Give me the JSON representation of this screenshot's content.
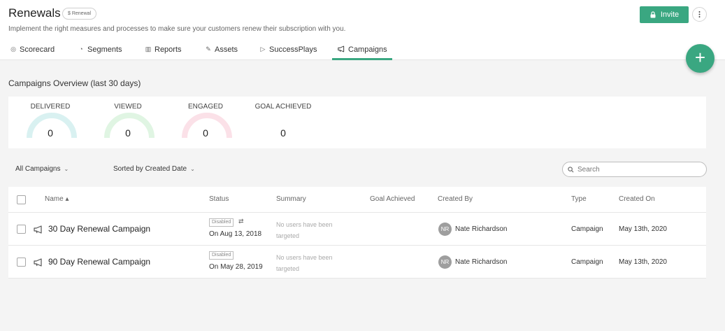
{
  "header": {
    "title": "Renewals",
    "badge": "$ Renewal",
    "subtitle": "Implement the right measures and processes to make sure your customers renew their subscription with you.",
    "invite_label": "Invite",
    "more_icon": "vertical-dots-icon"
  },
  "tabs": [
    {
      "label": "Scorecard",
      "icon": "◎"
    },
    {
      "label": "Segments",
      "icon": "◔"
    },
    {
      "label": "Reports",
      "icon": "▥"
    },
    {
      "label": "Assets",
      "icon": "✎"
    },
    {
      "label": "SuccessPlays",
      "icon": "▷"
    },
    {
      "label": "Campaigns",
      "icon": "📢",
      "active": true
    }
  ],
  "fab_label": "+",
  "overview": {
    "title": "Campaigns Overview (last 30 days)",
    "stats": [
      {
        "label": "DELIVERED",
        "value": "0",
        "color": "#d9f1f1"
      },
      {
        "label": "VIEWED",
        "value": "0",
        "color": "#e0f5e3"
      },
      {
        "label": "ENGAGED",
        "value": "0",
        "color": "#fbe1e8"
      },
      {
        "label": "GOAL ACHIEVED",
        "value": "0"
      }
    ]
  },
  "filters": {
    "campaigns": "All Campaigns",
    "sort": "Sorted by Created Date",
    "search_placeholder": "Search"
  },
  "table": {
    "columns": {
      "name": "Name ▴",
      "status": "Status",
      "summary": "Summary",
      "goal": "Goal Achieved",
      "created_by": "Created By",
      "type": "Type",
      "created_on": "Created On"
    },
    "rows": [
      {
        "name": "30 Day Renewal Campaign",
        "status": "Disabled",
        "status_date": "On Aug 13, 2018",
        "recurring": true,
        "summary": "No users have been targeted",
        "initials": "NR",
        "created_by": "Nate Richardson",
        "type": "Campaign",
        "created_on": "May 13th, 2020"
      },
      {
        "name": "90 Day Renewal Campaign",
        "status": "Disabled",
        "status_date": "On May 28, 2019",
        "recurring": false,
        "summary": "No users have been targeted",
        "initials": "NR",
        "created_by": "Nate Richardson",
        "type": "Campaign",
        "created_on": "May 13th, 2020"
      }
    ]
  },
  "colors": {
    "accent": "#3aa781"
  }
}
